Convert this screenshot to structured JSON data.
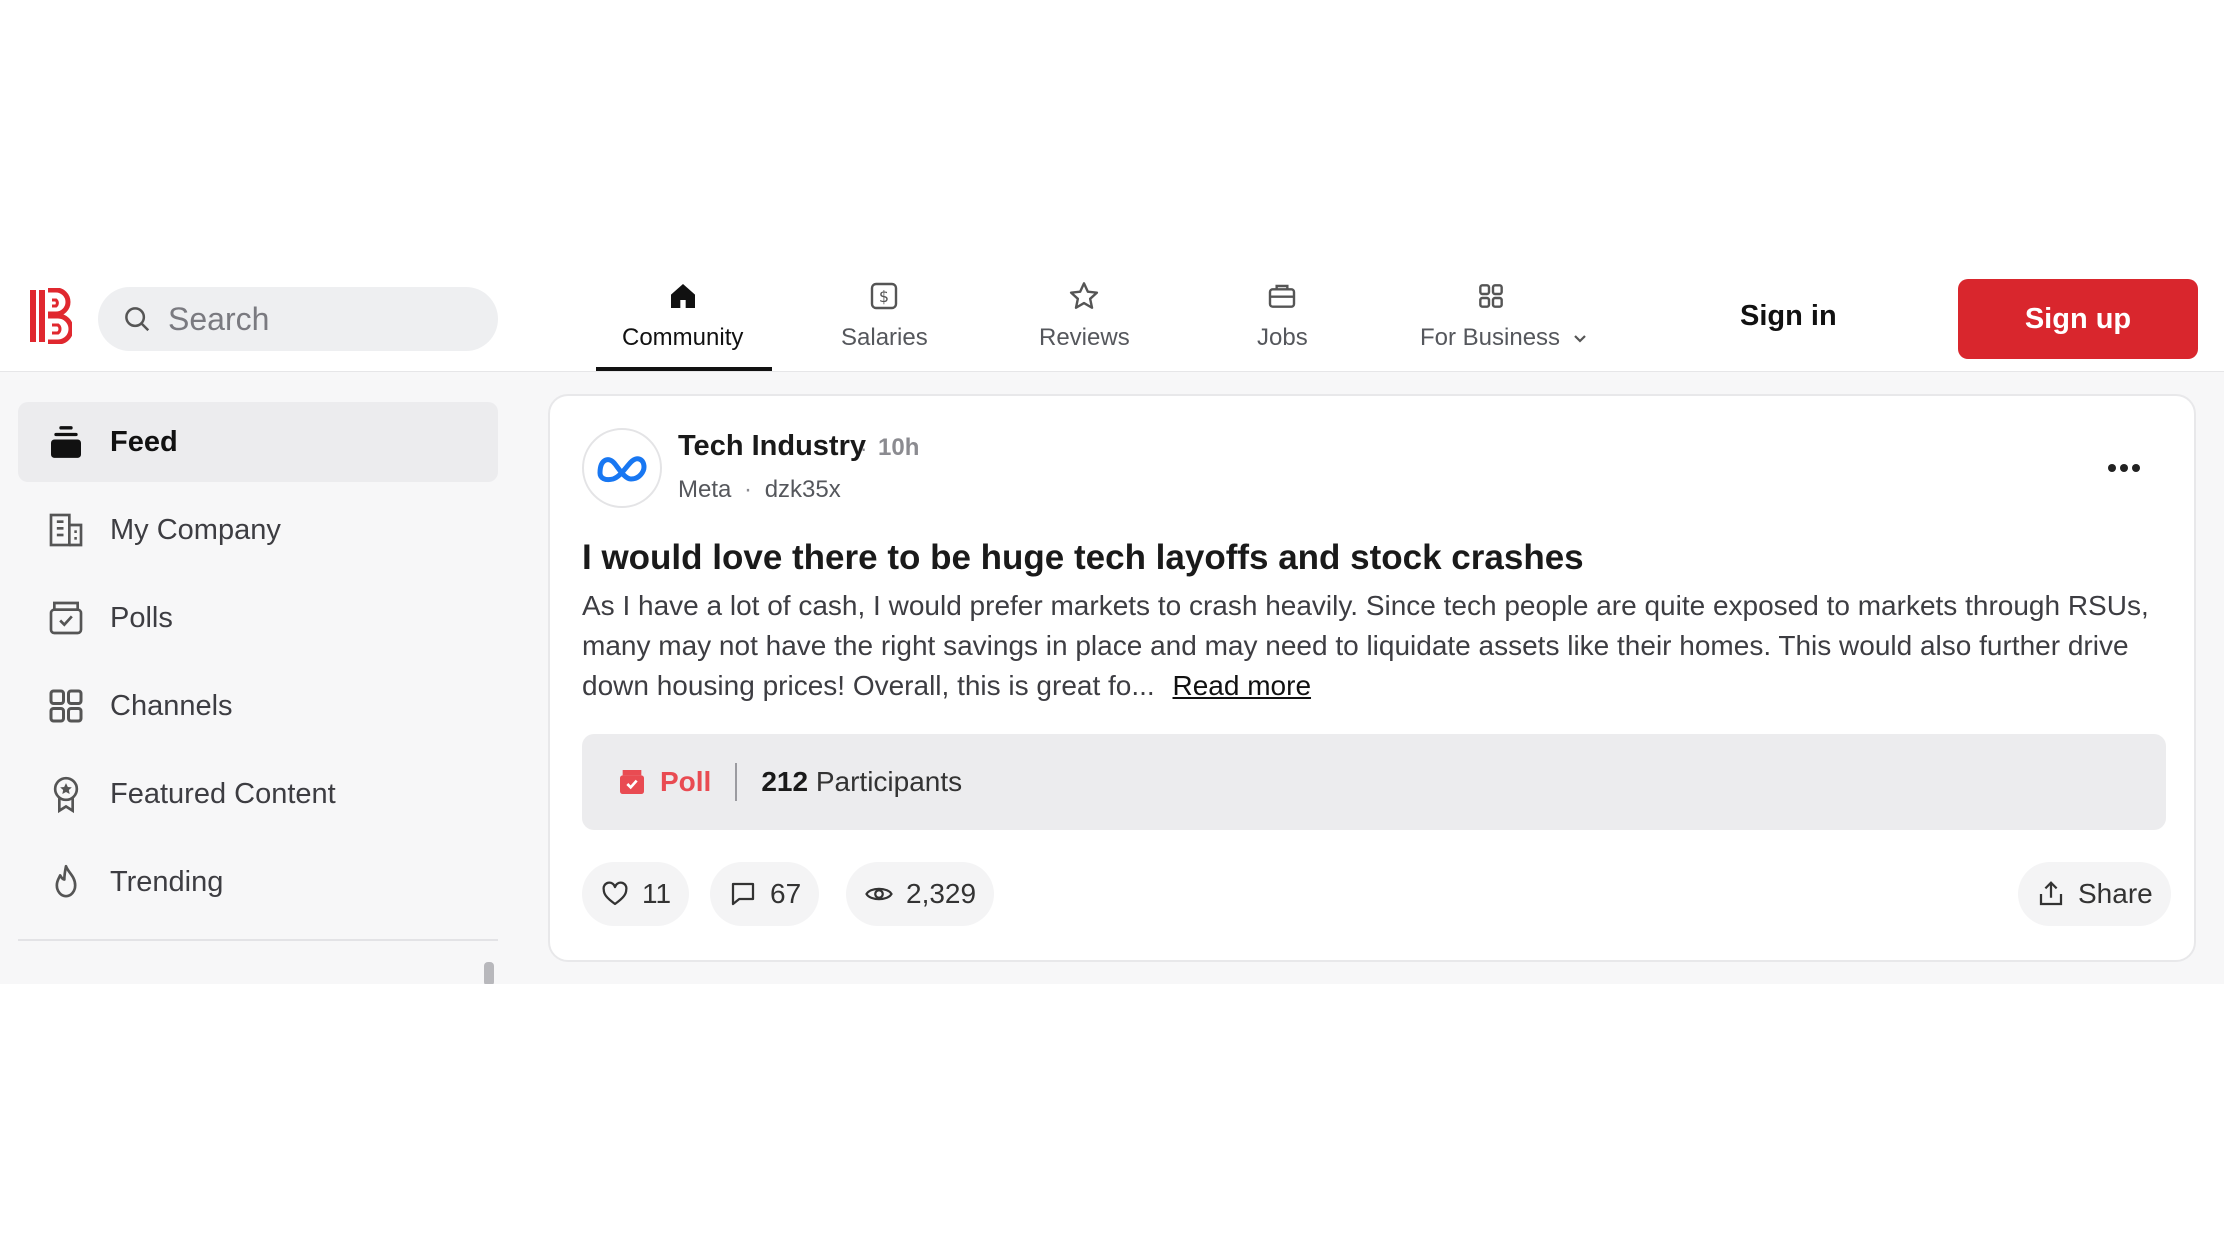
{
  "header": {
    "search_placeholder": "Search",
    "nav": [
      {
        "label": "Community",
        "icon": "home-icon",
        "active": true
      },
      {
        "label": "Salaries",
        "icon": "salary-icon"
      },
      {
        "label": "Reviews",
        "icon": "star-icon"
      },
      {
        "label": "Jobs",
        "icon": "briefcase-icon"
      },
      {
        "label": "For Business",
        "icon": "grid-icon"
      }
    ],
    "sign_in": "Sign in",
    "sign_up": "Sign up",
    "brand_color": "#d9262d"
  },
  "sidebar": {
    "items": [
      {
        "label": "Feed",
        "icon": "feed-icon",
        "active": true
      },
      {
        "label": "My Company",
        "icon": "building-icon"
      },
      {
        "label": "Polls",
        "icon": "poll-icon"
      },
      {
        "label": "Channels",
        "icon": "channels-icon"
      },
      {
        "label": "Featured Content",
        "icon": "award-icon"
      },
      {
        "label": "Trending",
        "icon": "flame-icon"
      }
    ]
  },
  "post": {
    "channel": "Tech Industry",
    "time": "10h",
    "company": "Meta",
    "username": "dzk35x",
    "title": "I would love there to be huge tech layoffs and stock crashes",
    "body": "As I have a lot of cash, I would prefer markets to crash heavily. Since tech people are quite exposed to markets through RSUs, many may not have the right savings in place and may need to liquidate assets like their homes. This would also further drive down housing prices!  Overall, this is great fo...",
    "read_more": "Read more",
    "poll": {
      "label": "Poll",
      "count": "212",
      "count_label": "Participants"
    },
    "likes": "11",
    "comments": "67",
    "views": "2,329",
    "share": "Share"
  }
}
